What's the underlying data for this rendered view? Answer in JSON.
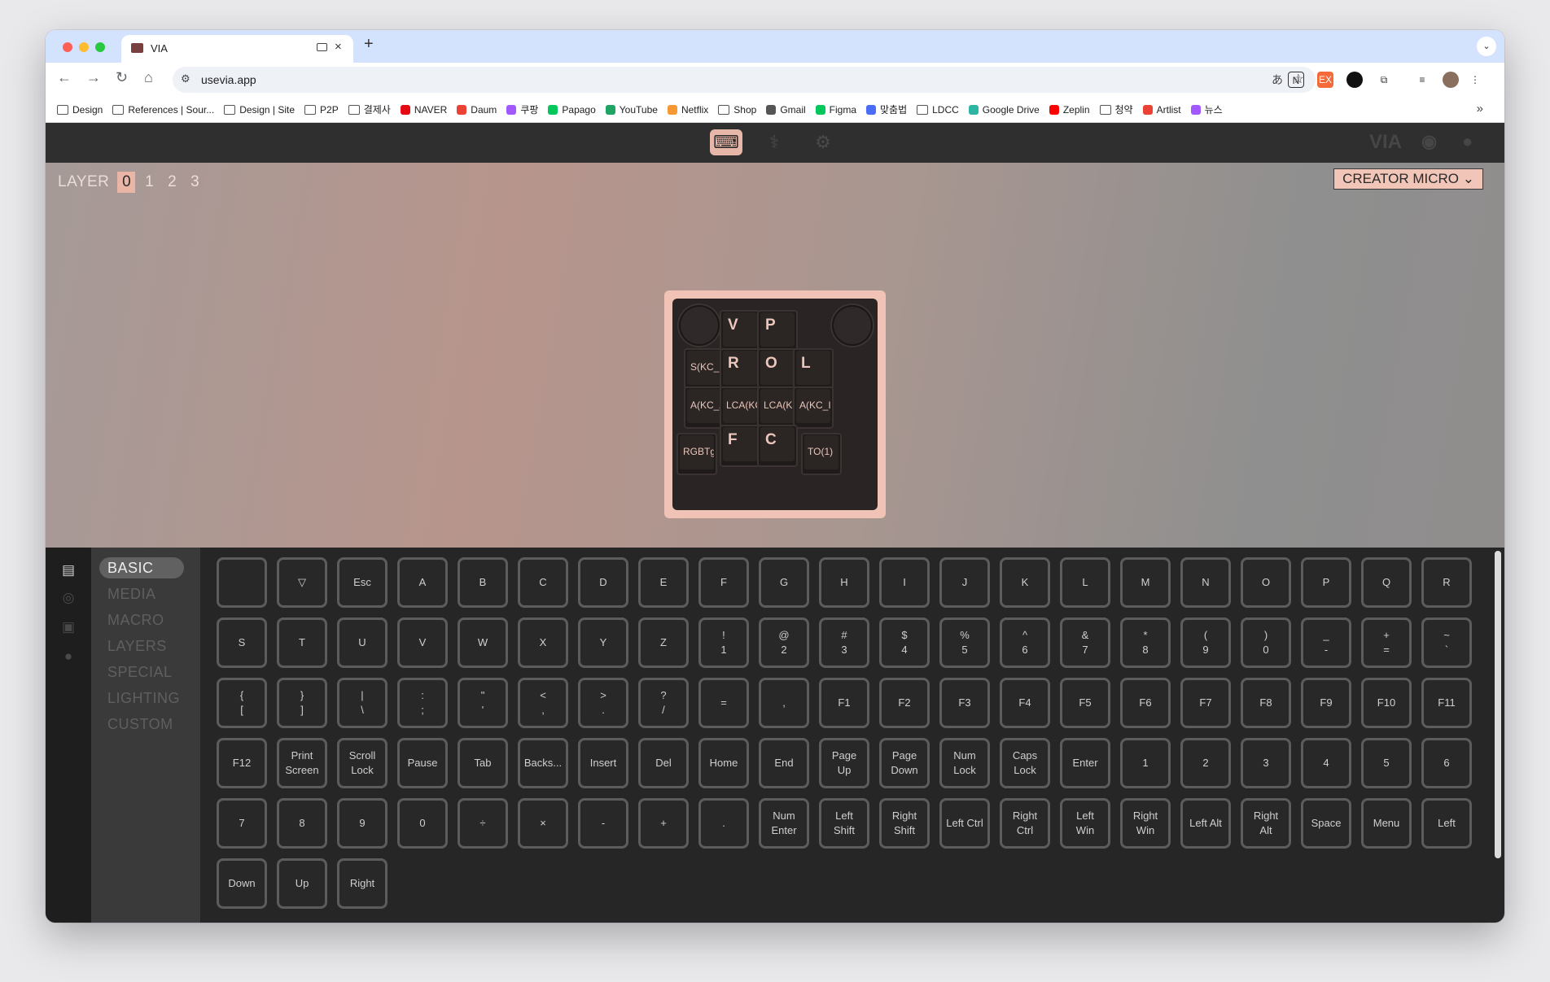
{
  "browser": {
    "tab_title": "VIA",
    "new_tab": "+",
    "tab_close": "×",
    "url": "usevia.app",
    "bookmarks": [
      {
        "label": "Design",
        "icon": "folder-icon"
      },
      {
        "label": "References | Sour...",
        "icon": "folder-icon"
      },
      {
        "label": "Design | Site",
        "icon": "folder-icon"
      },
      {
        "label": "P2P",
        "icon": "folder-icon"
      },
      {
        "label": "결제사",
        "icon": "folder-icon"
      },
      {
        "label": "NAVER",
        "icon": "naver-icon"
      },
      {
        "label": "Daum",
        "icon": "daum-icon"
      },
      {
        "label": "쿠팡",
        "icon": "coupang-icon"
      },
      {
        "label": "Papago",
        "icon": "papago-icon"
      },
      {
        "label": "YouTube",
        "icon": "youtube-icon"
      },
      {
        "label": "Netflix",
        "icon": "netflix-icon"
      },
      {
        "label": "Shop",
        "icon": "folder-icon"
      },
      {
        "label": "Gmail",
        "icon": "gmail-icon"
      },
      {
        "label": "Figma",
        "icon": "figma-icon"
      },
      {
        "label": "맞춤법",
        "icon": "naver-icon"
      },
      {
        "label": "LDCC",
        "icon": "folder-icon"
      },
      {
        "label": "Google Drive",
        "icon": "drive-icon"
      },
      {
        "label": "Zeplin",
        "icon": "zeplin-icon"
      },
      {
        "label": "청약",
        "icon": "folder-icon"
      },
      {
        "label": "Artlist",
        "icon": "artlist-icon"
      },
      {
        "label": "뉴스",
        "icon": "globe-icon"
      }
    ],
    "bookmarks_more": "»"
  },
  "app": {
    "layer_label": "LAYER",
    "layers": [
      "0",
      "1",
      "2",
      "3"
    ],
    "active_layer": "0",
    "device_name": "CREATOR MICRO",
    "device_chevron": "⌄",
    "header_right_logo": "VIA",
    "keyboard_keys": [
      {
        "label": "V",
        "small": false
      },
      {
        "label": "P",
        "small": false
      },
      {
        "label": "S(KC_L",
        "small": true
      },
      {
        "label": "R",
        "small": false
      },
      {
        "label": "O",
        "small": false
      },
      {
        "label": "L",
        "small": false
      },
      {
        "label": "A(KC_A",
        "small": true
      },
      {
        "label": "LCA(KC",
        "small": true
      },
      {
        "label": "LCA(KC",
        "small": true
      },
      {
        "label": "A(KC_I",
        "small": true
      },
      {
        "label": "F",
        "small": false
      },
      {
        "label": "C",
        "small": false
      },
      {
        "label": "RGBTg",
        "small": true
      },
      {
        "label": "TO(1)",
        "small": true
      }
    ],
    "categories": [
      "BASIC",
      "MEDIA",
      "MACRO",
      "LAYERS",
      "SPECIAL",
      "LIGHTING",
      "CUSTOM"
    ],
    "active_category": "BASIC",
    "basic_keys": [
      "",
      "▽",
      "Esc",
      "A",
      "B",
      "C",
      "D",
      "E",
      "F",
      "G",
      "H",
      "I",
      "J",
      "K",
      "L",
      "M",
      "N",
      "O",
      "P",
      "Q",
      "R",
      "S",
      "T",
      "U",
      "V",
      "W",
      "X",
      "Y",
      "Z",
      "!\n1",
      "@\n2",
      "#\n3",
      "$\n4",
      "%\n5",
      "^\n6",
      "&\n7",
      "*\n8",
      "(\n9",
      ")\n0",
      "_\n-",
      "+\n=",
      "~\n`",
      "{\n[",
      "}\n]",
      "|\n\\",
      ":\n;",
      "\"\n'",
      "<\n,",
      ">\n.",
      "?\n/",
      "=",
      ",",
      "F1",
      "F2",
      "F3",
      "F4",
      "F5",
      "F6",
      "F7",
      "F8",
      "F9",
      "F10",
      "F11",
      "F12",
      "Print\nScreen",
      "Scroll\nLock",
      "Pause",
      "Tab",
      "Backs...",
      "Insert",
      "Del",
      "Home",
      "End",
      "Page\nUp",
      "Page\nDown",
      "Num\nLock",
      "Caps\nLock",
      "Enter",
      "1",
      "2",
      "3",
      "4",
      "5",
      "6",
      "7",
      "8",
      "9",
      "0",
      "÷",
      "×",
      "-",
      "+",
      ".",
      "Num\nEnter",
      "Left\nShift",
      "Right\nShift",
      "Left Ctrl",
      "Right\nCtrl",
      "Left\nWin",
      "Right\nWin",
      "Left Alt",
      "Right\nAlt",
      "Space",
      "Menu",
      "Left",
      "Down",
      "Up",
      "Right"
    ]
  },
  "colors": {
    "accent": "#e6b6a9",
    "panel_dark": "#262626",
    "keycap_legend": "#ecc6bb"
  }
}
